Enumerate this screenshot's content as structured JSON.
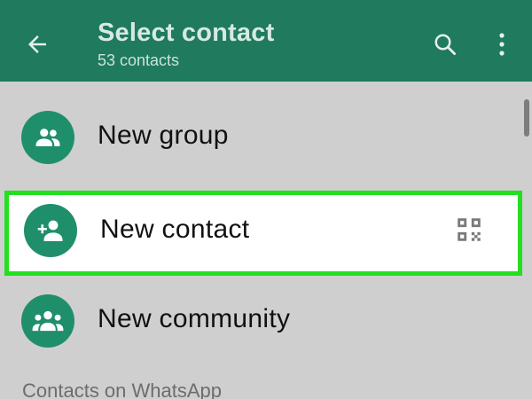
{
  "header": {
    "title": "Select contact",
    "subtitle": "53 contacts",
    "back_icon": "arrow-left-icon",
    "search_icon": "search-icon",
    "menu_icon": "more-vert-icon",
    "background_color": "#1f7a5e"
  },
  "actions": [
    {
      "label": "New group",
      "icon": "group-icon"
    },
    {
      "label": "New contact",
      "icon": "person-add-icon",
      "trailing_icon": "qr-code-icon",
      "highlighted": true
    },
    {
      "label": "New community",
      "icon": "community-icon"
    }
  ],
  "section_header": "Contacts on WhatsApp",
  "colors": {
    "accent": "#1f8f6b",
    "highlight_border": "#22e01e"
  }
}
